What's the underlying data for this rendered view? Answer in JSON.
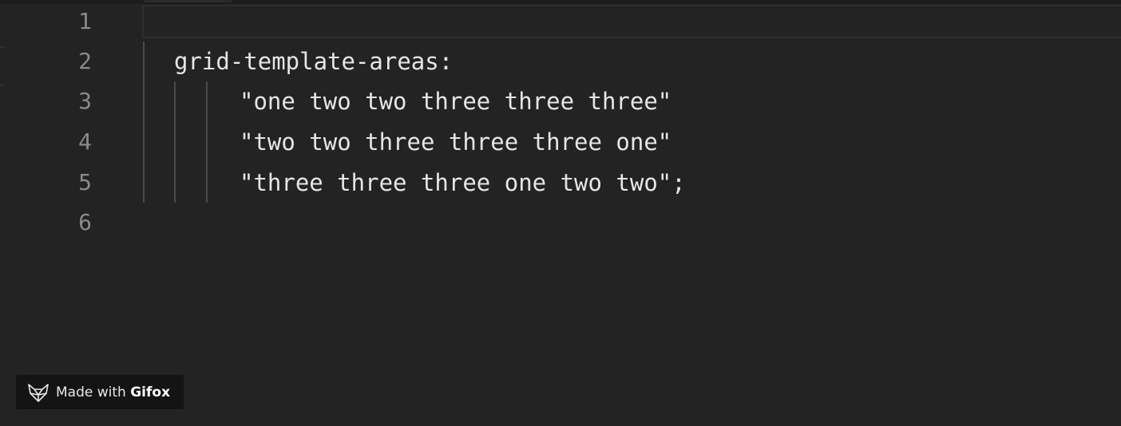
{
  "editor": {
    "lines": [
      {
        "number": "1",
        "text": ""
      },
      {
        "number": "2",
        "text": "grid-template-areas:"
      },
      {
        "number": "3",
        "text": "\"one two two three three three\""
      },
      {
        "number": "4",
        "text": "\"two two three three three one\""
      },
      {
        "number": "5",
        "text": "\"three three three one two two\";"
      },
      {
        "number": "6",
        "text": ""
      }
    ]
  },
  "watermark": {
    "prefix": "Made with ",
    "brand": "Gifox",
    "icon": "fox-icon"
  },
  "colors": {
    "background": "#232323",
    "text": "#e6e6e6",
    "line_number": "#8a8a8a",
    "badge_background": "#141414"
  }
}
